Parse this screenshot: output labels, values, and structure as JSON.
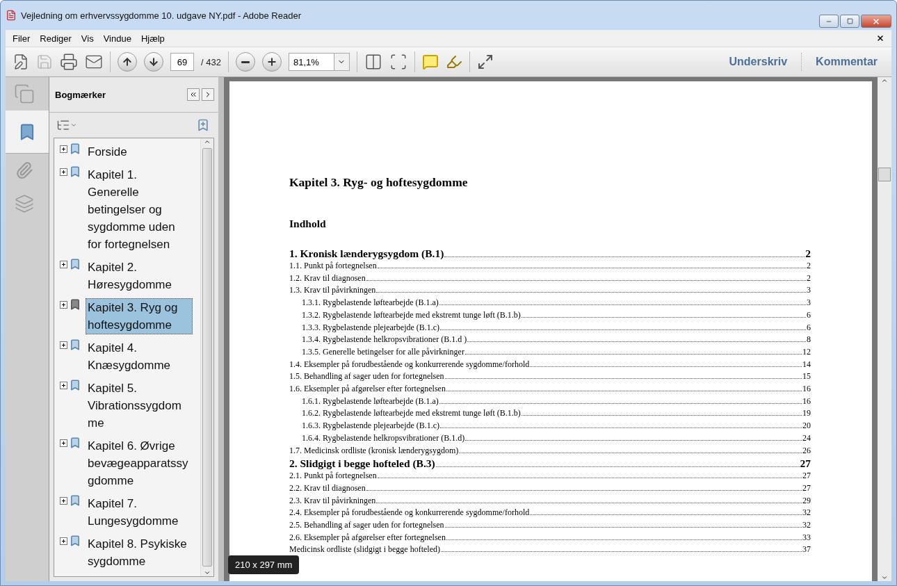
{
  "window": {
    "title": "Vejledning om erhvervssygdomme 10. udgave NY.pdf - Adobe Reader"
  },
  "menu": [
    "Filer",
    "Rediger",
    "Vis",
    "Vindue",
    "Hjælp"
  ],
  "toolbar": {
    "page_number": "69",
    "page_total": "/ 432",
    "zoom": "81,1%",
    "actions": [
      "Underskriv",
      "Kommentar"
    ]
  },
  "sidebar": {
    "tabs": [
      {
        "kind": "pages",
        "selected": false
      },
      {
        "kind": "bookmarks",
        "selected": true
      },
      {
        "kind": "attachments",
        "selected": false
      },
      {
        "kind": "layers",
        "selected": false
      }
    ]
  },
  "bookmarks": {
    "title": "Bogmærker",
    "items": [
      {
        "label": "Forside",
        "expanded": false,
        "selected": false
      },
      {
        "label": "Kapitel 1. Generelle betingelser og sygdomme uden for fortegnelsen",
        "expanded": false,
        "selected": false
      },
      {
        "label": "Kapitel 2. Høresygdomme",
        "expanded": false,
        "selected": false
      },
      {
        "label": "Kapitel 3. Ryg og hoftesygdomme",
        "expanded": false,
        "selected": true
      },
      {
        "label": "Kapitel 4. Knæsygdomme",
        "expanded": false,
        "selected": false
      },
      {
        "label": "Kapitel 5. Vibrationssygdomme",
        "expanded": false,
        "selected": false
      },
      {
        "label": "Kapitel 6. Øvrige bevægeapparatssygdomme",
        "expanded": false,
        "selected": false
      },
      {
        "label": "Kapitel 7. Lungesygdomme",
        "expanded": false,
        "selected": false
      },
      {
        "label": "Kapitel 8. Psykiske sygdomme",
        "expanded": false,
        "selected": false
      }
    ]
  },
  "document": {
    "heading": "Kapitel 3. Ryg- og hoftesygdomme",
    "subheading": "Indhold",
    "toc": [
      {
        "kind": "chapter",
        "label": "1. Kronisk lænderygsygdom (B.1)",
        "page": "2"
      },
      {
        "kind": "section",
        "label": "1.1. Punkt på fortegnelsen",
        "page": "2"
      },
      {
        "kind": "section",
        "label": "1.2. Krav til diagnosen",
        "page": "2"
      },
      {
        "kind": "section",
        "label": "1.3. Krav til påvirkningen",
        "page": "3"
      },
      {
        "kind": "subsection",
        "label": "1.3.1. Rygbelastende løftearbejde (B.1.a)",
        "page": "3"
      },
      {
        "kind": "subsection",
        "label": "1.3.2. Rygbelastende løftearbejde med ekstremt tunge løft (B.1.b)",
        "page": "6"
      },
      {
        "kind": "subsection",
        "label": "1.3.3. Rygbelastende plejearbejde (B.1.c)",
        "page": "6"
      },
      {
        "kind": "subsection",
        "label": "1.3.4. Rygbelastende helkropsvibrationer (B.1.d )",
        "page": "8"
      },
      {
        "kind": "subsection",
        "label": "1.3.5. Generelle betingelser for alle påvirkninger",
        "page": "12"
      },
      {
        "kind": "section",
        "label": "1.4. Eksempler på forudbestående og konkurrerende sygdomme/forhold",
        "page": "14"
      },
      {
        "kind": "section",
        "label": "1.5. Behandling af sager uden for fortegnelsen",
        "page": "15"
      },
      {
        "kind": "section",
        "label": "1.6.  Eksempler på afgørelser efter fortegnelsen",
        "page": "16"
      },
      {
        "kind": "subsection",
        "label": "1.6.1. Rygbelastende løftearbejde (B.1.a)",
        "page": "16"
      },
      {
        "kind": "subsection",
        "label": "1.6.2. Rygbelastende løftearbejde med ekstremt tunge løft (B.1.b)",
        "page": "19"
      },
      {
        "kind": "subsection",
        "label": "1.6.3. Rygbelastende plejearbejde (B.1.c)",
        "page": "20"
      },
      {
        "kind": "subsection",
        "label": "1.6.4. Rygbelastende helkropsvibrationer (B.1.d)",
        "page": "24"
      },
      {
        "kind": "section",
        "label": "1.7. Medicinsk ordliste (kronisk lænderygsygdom)",
        "page": "26"
      },
      {
        "kind": "chapter",
        "label": "2. Slidgigt i begge hofteled (B.3)",
        "page": "27"
      },
      {
        "kind": "section",
        "label": "2.1. Punkt på fortegnelsen",
        "page": "27"
      },
      {
        "kind": "section",
        "label": "2.2. Krav til diagnosen",
        "page": "27"
      },
      {
        "kind": "section",
        "label": "2.3. Krav til påvirkningen",
        "page": "29"
      },
      {
        "kind": "section",
        "label": "2.4. Eksempler på forudbestående og konkurrerende sygdomme/forhold",
        "page": "32"
      },
      {
        "kind": "section",
        "label": "2.5. Behandling af sager uden for fortegnelsen",
        "page": "32"
      },
      {
        "kind": "section",
        "label": "2.6. Eksempler på afgørelser efter fortegnelsen",
        "page": "33"
      },
      {
        "kind": "section",
        "label": "Medicinsk ordliste (slidgigt i begge hofteled)",
        "page": "37"
      }
    ]
  },
  "page_size_tooltip": "210 x 297 mm"
}
